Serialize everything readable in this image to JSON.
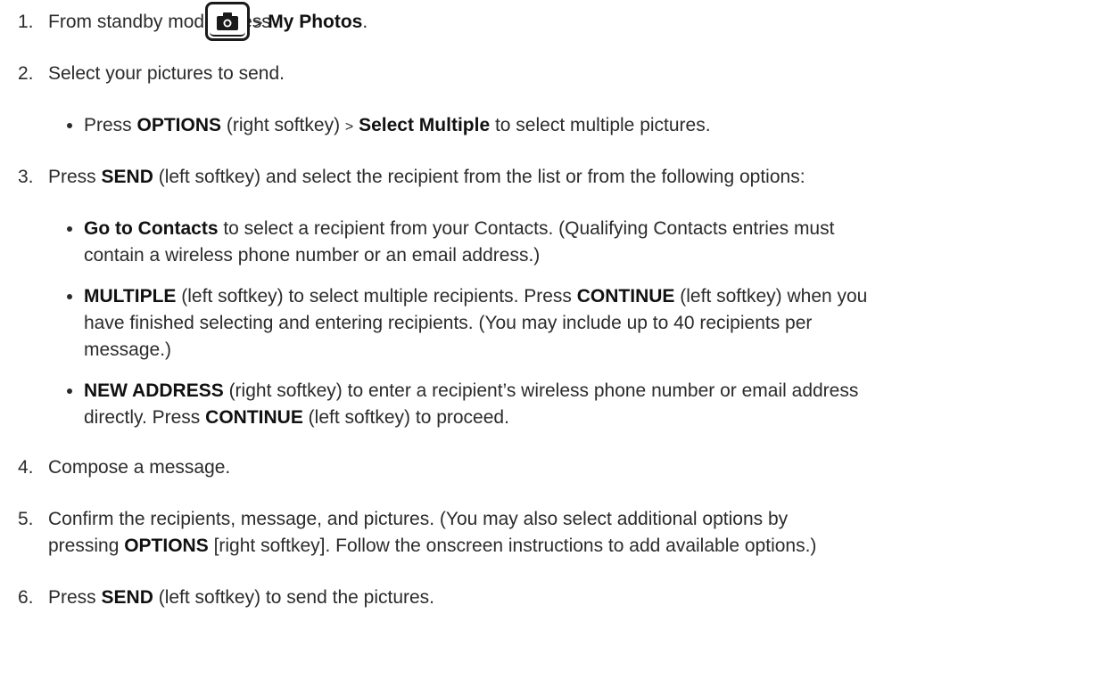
{
  "steps": [
    {
      "num": "1.",
      "pre": "From standby mode, press ",
      "gt": ">",
      "bold": "My Photos",
      "post": "."
    },
    {
      "num": "2.",
      "text": "Select your pictures to send."
    },
    {
      "num": "3.",
      "pre": "Press ",
      "bold": "SEND",
      "post": " (left softkey) and select the recipient from the list or from the following options:"
    },
    {
      "num": "4.",
      "text": "Compose a message."
    },
    {
      "num": "5.",
      "pre": "Confirm the recipients, message, and pictures. (You may also select additional options by",
      "line2_pre": "pressing ",
      "bold": "OPTIONS",
      "line2_post": " [right softkey]. Follow the onscreen instructions to add available options.)"
    },
    {
      "num": "6.",
      "pre": "Press ",
      "bold": "SEND",
      "post": " (left softkey) to send the pictures."
    }
  ],
  "step2_bullet": {
    "pre": "Press ",
    "bold1": "OPTIONS",
    "mid1": " (right softkey) ",
    "gt": ">",
    "bold2": "Select Multiple",
    "post": " to select multiple pictures."
  },
  "step3_bullets": [
    {
      "bold": "Go to Contacts",
      "line1": " to select a recipient from your Contacts. (Qualifying Contacts entries must",
      "line2": "contain a wireless phone number or an email address.)"
    },
    {
      "bold": "MULTIPLE",
      "mid": " (left softkey) to select multiple recipients. Press ",
      "bold2": "CONTINUE",
      "post": " (left softkey) when you",
      "line2": "have finished selecting and entering recipients. (You may include up to 40 recipients per",
      "line3": "message.)"
    },
    {
      "bold": "NEW ADDRESS",
      "line1": " (right softkey) to enter a recipient’s wireless phone number or email address",
      "line2_pre": "directly. Press ",
      "bold2": "CONTINUE",
      "line2_post": " (left softkey) to proceed."
    }
  ],
  "icons": {
    "camera_key": "camera-key-icon",
    "bullet": "bullet-icon"
  }
}
